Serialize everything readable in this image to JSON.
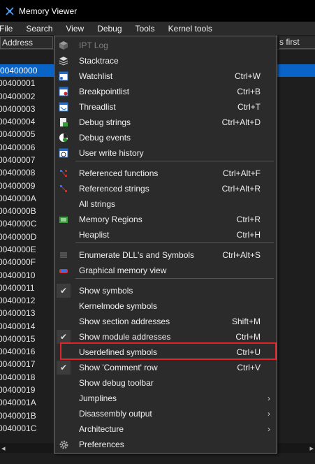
{
  "window": {
    "title": "Memory Viewer"
  },
  "menubar": [
    "File",
    "Search",
    "View",
    "Debug",
    "Tools",
    "Kernel tools"
  ],
  "address_header": "Address",
  "right_header": "s first",
  "addresses": [
    "00400000",
    "00400001",
    "00400002",
    "00400003",
    "00400004",
    "00400005",
    "00400006",
    "00400007",
    "00400008",
    "00400009",
    "0040000A",
    "0040000B",
    "0040000C",
    "0040000D",
    "0040000E",
    "0040000F",
    "00400010",
    "00400011",
    "00400012",
    "00400013",
    "00400014",
    "00400015",
    "00400016",
    "00400017",
    "00400018",
    "00400019",
    "0040001A",
    "0040001B",
    "0040001C"
  ],
  "menu_items": [
    {
      "label": "IPT Log",
      "shortcut": "",
      "icon": "cube-icon",
      "disabled": true
    },
    {
      "label": "Stacktrace",
      "shortcut": "",
      "icon": "stack-icon"
    },
    {
      "label": "Watchlist",
      "shortcut": "Ctrl+W",
      "icon": "watchlist-icon"
    },
    {
      "label": "Breakpointlist",
      "shortcut": "Ctrl+B",
      "icon": "breakpoint-icon"
    },
    {
      "label": "Threadlist",
      "shortcut": "Ctrl+T",
      "icon": "thread-icon"
    },
    {
      "label": "Debug strings",
      "shortcut": "Ctrl+Alt+D",
      "icon": "debug-strings-icon"
    },
    {
      "label": "Debug events",
      "shortcut": "",
      "icon": "debug-events-icon"
    },
    {
      "label": "User write history",
      "shortcut": "",
      "icon": "clock-icon"
    },
    {
      "label": "Referenced functions",
      "shortcut": "Ctrl+Alt+F",
      "icon": "functions-icon"
    },
    {
      "label": "Referenced strings",
      "shortcut": "Ctrl+Alt+R",
      "icon": "strings-icon"
    },
    {
      "label": "All strings",
      "shortcut": "",
      "icon": ""
    },
    {
      "label": "Memory Regions",
      "shortcut": "Ctrl+R",
      "icon": "memory-regions-icon"
    },
    {
      "label": "Heaplist",
      "shortcut": "Ctrl+H",
      "icon": ""
    },
    {
      "label": "Enumerate DLL's and Symbols",
      "shortcut": "Ctrl+Alt+S",
      "icon": "list-icon"
    },
    {
      "label": "Graphical memory view",
      "shortcut": "",
      "icon": "graph-icon"
    },
    {
      "label": "Show symbols",
      "shortcut": "",
      "icon": "",
      "checked": true
    },
    {
      "label": "Kernelmode symbols",
      "shortcut": "",
      "icon": ""
    },
    {
      "label": "Show section addresses",
      "shortcut": "Shift+M",
      "icon": ""
    },
    {
      "label": "Show module addresses",
      "shortcut": "Ctrl+M",
      "icon": "",
      "checked": true
    },
    {
      "label": "Userdefined symbols",
      "shortcut": "Ctrl+U",
      "icon": ""
    },
    {
      "label": "Show 'Comment' row",
      "shortcut": "Ctrl+V",
      "icon": "",
      "checked": true
    },
    {
      "label": "Show debug toolbar",
      "shortcut": "",
      "icon": ""
    },
    {
      "label": "Jumplines",
      "shortcut": "",
      "icon": "",
      "submenu": true
    },
    {
      "label": "Disassembly output",
      "shortcut": "",
      "icon": "",
      "submenu": true
    },
    {
      "label": "Architecture",
      "shortcut": "",
      "icon": "",
      "submenu": true
    },
    {
      "label": "Preferences",
      "shortcut": "",
      "icon": "gear-icon"
    }
  ],
  "submenu_arrow": "›",
  "check_mark": "✔"
}
